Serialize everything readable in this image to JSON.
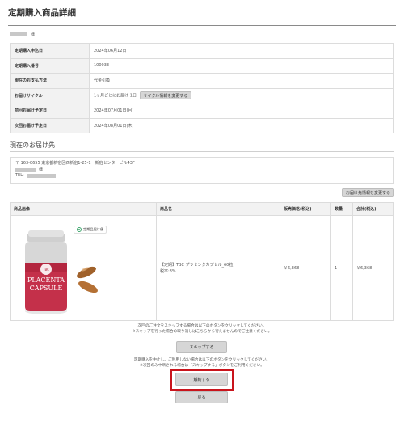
{
  "page": {
    "title": "定期購入商品詳細"
  },
  "customer": {
    "suffix": "様"
  },
  "info": {
    "rows": [
      {
        "label": "定期購入申込日",
        "value": "2024年06月12日"
      },
      {
        "label": "定期購入番号",
        "value": "100033"
      },
      {
        "label": "現在のお支払方法",
        "value": "代金引換"
      },
      {
        "label": "お届けサイクル",
        "value": "1ヶ月ごとにお届け 1日",
        "button": "サイクル情報を変更する"
      },
      {
        "label": "前回お届け予定日",
        "value": "2024年07月01日(月)"
      },
      {
        "label": "次回お届け予定日",
        "value": "2024年08月01日(木)"
      }
    ]
  },
  "delivery": {
    "title": "現在のお届け先",
    "address": "〒 163-0655 東京都新宿区西新宿1-25-1　新宿センタービル43F",
    "name_suffix": "様",
    "tel_label": "TEL:",
    "change_button": "お届け先情報を変更する"
  },
  "items": {
    "headers": [
      "商品画像",
      "商品名",
      "販売価格(税込)",
      "数量",
      "合計(税込)"
    ],
    "row": {
      "badge": "定期品届け便",
      "product_brand": "TBC",
      "product_label_line1": "PLACENTA",
      "product_label_line2": "CAPSULE",
      "name_line1": "【定期】TBC プラセンタカプセル_60粒",
      "name_line2": "税率:8%",
      "price": "￥6,368",
      "qty": "1",
      "total": "￥6,368"
    }
  },
  "skip": {
    "note1": "次回のご注文をスキップする場合は以下のボタンをクリックしてください。",
    "note2": "※スキップを行った場合の取り消しはこちらから行えませんのでご注意ください。",
    "button": "スキップする"
  },
  "cancel": {
    "note1": "定期購入を中止し、ご利用しない場合は以下のボタンをクリックしてください。",
    "note2": "※次回のみ中断される場合は「スキップする」ボタンをご利用ください。",
    "button": "解約する"
  },
  "back": {
    "button": "戻る"
  },
  "colors": {
    "highlight": "#c9141c",
    "button_bg": "#d6d6d6",
    "header_bg": "#f2f2f2"
  }
}
